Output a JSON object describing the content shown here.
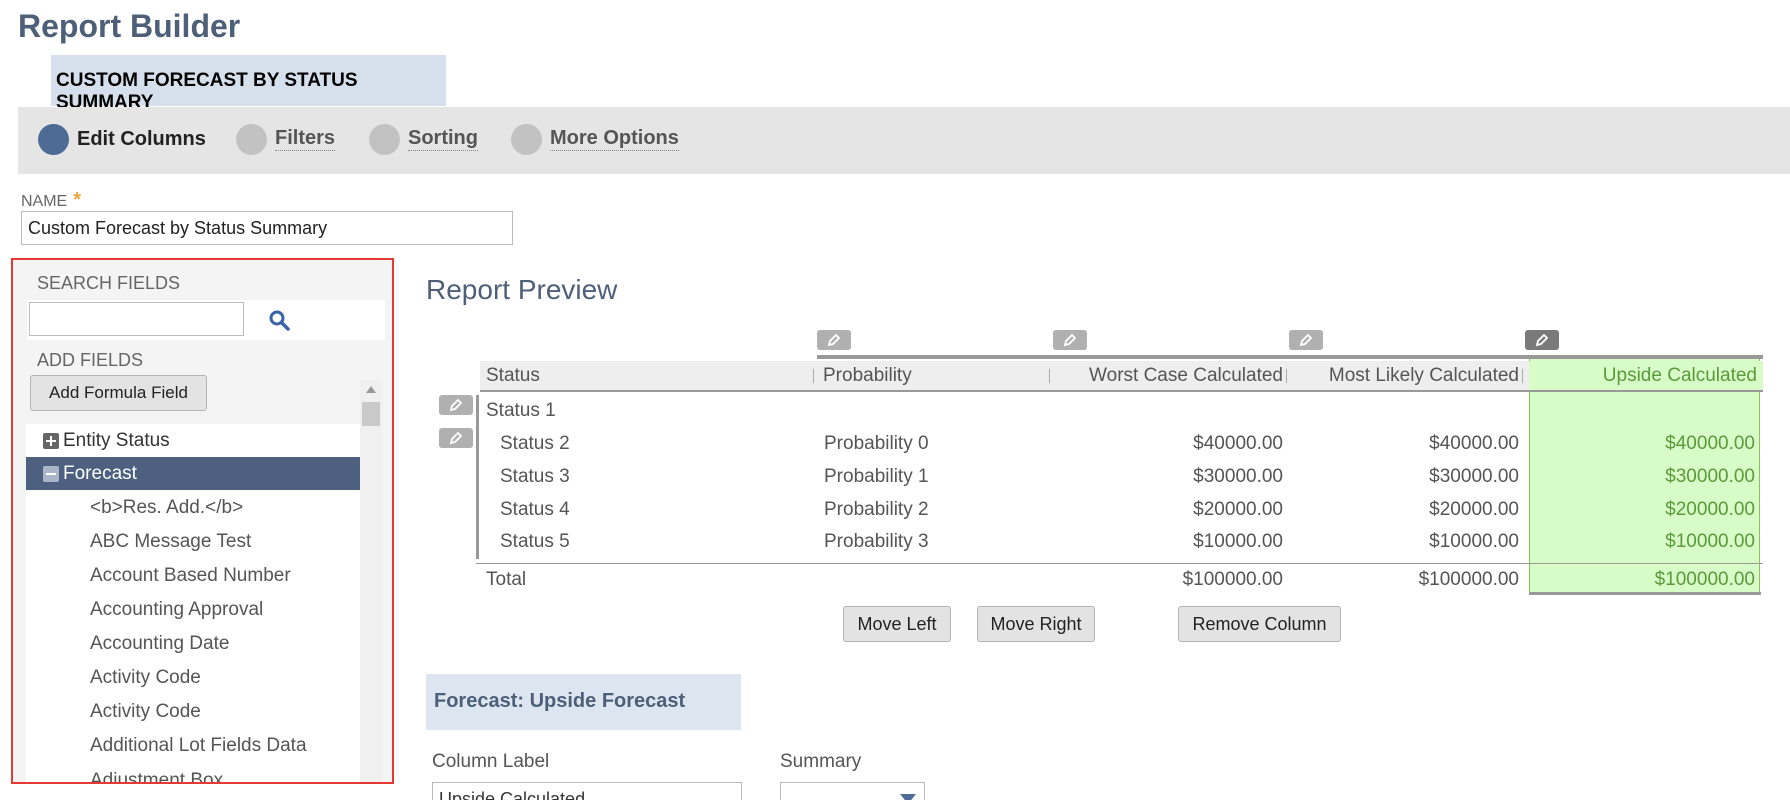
{
  "header": {
    "title": "Report Builder",
    "report_name": "CUSTOM FORECAST BY STATUS SUMMARY"
  },
  "steps": [
    {
      "label": "Edit Columns",
      "active": true
    },
    {
      "label": "Filters",
      "active": false
    },
    {
      "label": "Sorting",
      "active": false
    },
    {
      "label": "More Options",
      "active": false
    }
  ],
  "name_field": {
    "label": "NAME",
    "required_mark": "*",
    "value": "Custom Forecast by Status Summary"
  },
  "fields_panel": {
    "search_label": "SEARCH FIELDS",
    "search_value": "",
    "search_icon": "search-icon",
    "add_fields_label": "ADD FIELDS",
    "add_formula_label": "Add Formula Field",
    "groups": [
      {
        "label": "Entity Status",
        "expanded": false
      },
      {
        "label": "Forecast",
        "expanded": true
      }
    ],
    "items": [
      "<b>Res. Add.</b>",
      "ABC Message Test",
      "Account Based Number",
      "Accounting Approval",
      "Accounting Date",
      "Activity Code",
      "Activity Code",
      "Additional Lot Fields Data",
      "Adjustment Box"
    ]
  },
  "preview": {
    "title": "Report Preview",
    "columns": [
      "Status",
      "Probability",
      "Worst Case Calculated",
      "Most Likely Calculated",
      "Upside Calculated"
    ],
    "group_row": "Status 1",
    "rows": [
      {
        "status": "Status 2",
        "probability": "Probability 0",
        "worst": "$40000.00",
        "likely": "$40000.00",
        "upside": "$40000.00"
      },
      {
        "status": "Status 3",
        "probability": "Probability 1",
        "worst": "$30000.00",
        "likely": "$30000.00",
        "upside": "$30000.00"
      },
      {
        "status": "Status 4",
        "probability": "Probability 2",
        "worst": "$20000.00",
        "likely": "$20000.00",
        "upside": "$20000.00"
      },
      {
        "status": "Status 5",
        "probability": "Probability 3",
        "worst": "$10000.00",
        "likely": "$10000.00",
        "upside": "$10000.00"
      }
    ],
    "total": {
      "label": "Total",
      "worst": "$100000.00",
      "likely": "$100000.00",
      "upside": "$100000.00"
    },
    "buttons": {
      "move_left": "Move Left",
      "move_right": "Move Right",
      "remove": "Remove Column"
    },
    "highlight_color": "#d8fcc8"
  },
  "column_detail": {
    "title": "Forecast: Upside Forecast",
    "column_label_label": "Column Label",
    "column_label_value": "Upside Calculated",
    "summary_label": "Summary",
    "summary_value": ""
  }
}
